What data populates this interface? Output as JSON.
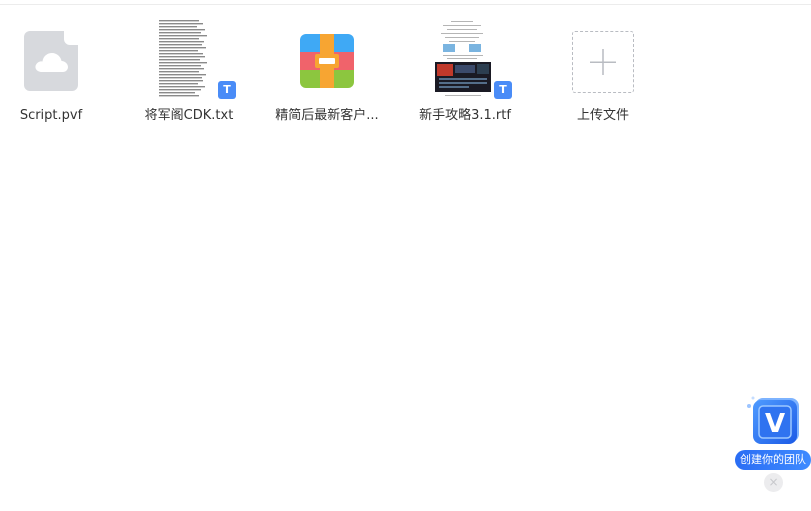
{
  "files": [
    {
      "name": "Script.pvf",
      "thumb_icon": "cloud-file-icon"
    },
    {
      "name": "将军阁CDK.txt",
      "thumb_icon": "text-preview-thumbnail",
      "badge": "T"
    },
    {
      "name": "精简后最新客户...",
      "thumb_icon": "archive-icon"
    },
    {
      "name": "新手攻略3.1.rtf",
      "thumb_icon": "document-preview-thumbnail",
      "badge": "T"
    }
  ],
  "upload": {
    "label": "上传文件",
    "icon": "plus-icon"
  },
  "team_widget": {
    "label": "创建你的团队",
    "logo_letter": "V",
    "close_glyph": "×"
  },
  "colors": {
    "accent": "#4a8cf7",
    "widget_blue": "#2a6df4",
    "zip_orange": "#f7a532",
    "zip_blue": "#3fa9f5",
    "zip_red": "#f0636b",
    "zip_green": "#8cc63f",
    "cloud_gray": "#d7d9dd"
  }
}
